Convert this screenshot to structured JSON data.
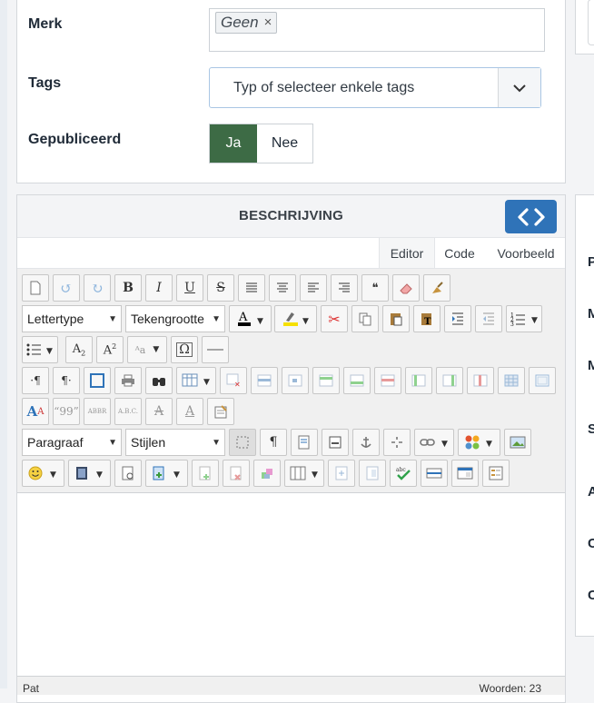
{
  "form": {
    "merk": {
      "label": "Merk",
      "chip": "Geen",
      "chip_remove": "×"
    },
    "tags": {
      "label": "Tags",
      "placeholder": "Typ of selecteer enkele tags"
    },
    "gepubliceerd": {
      "label": "Gepubliceerd",
      "yes": "Ja",
      "no": "Nee",
      "selected": "Ja"
    }
  },
  "beschrijving": {
    "title": "BESCHRIJVING",
    "tabs": [
      {
        "label": "Editor",
        "active": true
      },
      {
        "label": "Code"
      },
      {
        "label": "Voorbeeld"
      }
    ],
    "dropdowns": {
      "font": "Lettertype",
      "size": "Tekengrootte",
      "format": "Paragraaf",
      "styles": "Stijlen"
    },
    "status_left": "Pat",
    "status_right": "Woorden: 23"
  },
  "right_panel": {
    "letters": [
      "P",
      "M",
      "M",
      "S",
      "A",
      "C",
      "C"
    ]
  },
  "colors": {
    "accent": "#2f73b8",
    "toggle_on": "#3d6b45"
  }
}
